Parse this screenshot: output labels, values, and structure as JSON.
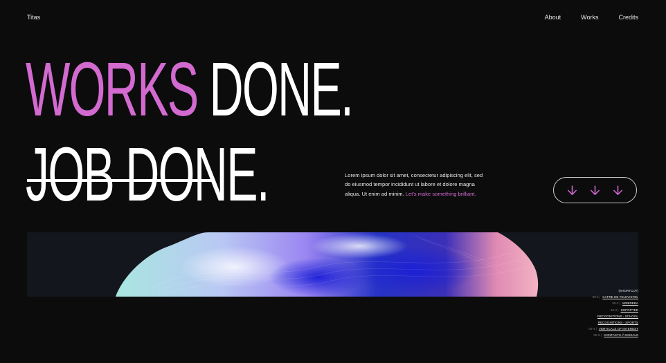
{
  "brand": "Titas",
  "nav": {
    "about": "About",
    "works": "Works",
    "credits": "Credits"
  },
  "headline": {
    "accent": "WORKS",
    "rest": " DONE.",
    "line2": "JOB DONE."
  },
  "intro": {
    "text": "Lorem ipsum dolor sit amet, consectetur adipiscing elit, sed do eiusmod tempor incididunt ut labore et dolore magna aliqua. Ut enim ad minim. ",
    "cta": "Let's make something brilliant."
  },
  "colors": {
    "accent": "#d36ad0",
    "background": "#0c0c0d",
    "hero_bg": "#14161d"
  },
  "scroll_button": {
    "icons": [
      "arrow-down-icon",
      "arrow-down-icon",
      "arrow-down-icon"
    ]
  },
  "shortcuts": {
    "title": "(SHORTCUT)",
    "items": [
      {
        "idx": "00-1 |",
        "label": "CAFRE DE TELEVISTEL"
      },
      {
        "idx": "00-2 |",
        "label": "WEBDEBA"
      },
      {
        "idx": "00-3 |",
        "label": "SOPOPTED"
      },
      {
        "idx": "",
        "label": "RECOGNITIONS - SCHOOL"
      },
      {
        "idx": "",
        "label": "RECOGNITIONS - SPORTS"
      },
      {
        "idx": "00-4 |",
        "label": "VERTICALS OF INTEREST"
      },
      {
        "idx": "00-5 |",
        "label": "CONTACTS // SOCIALS"
      }
    ]
  }
}
